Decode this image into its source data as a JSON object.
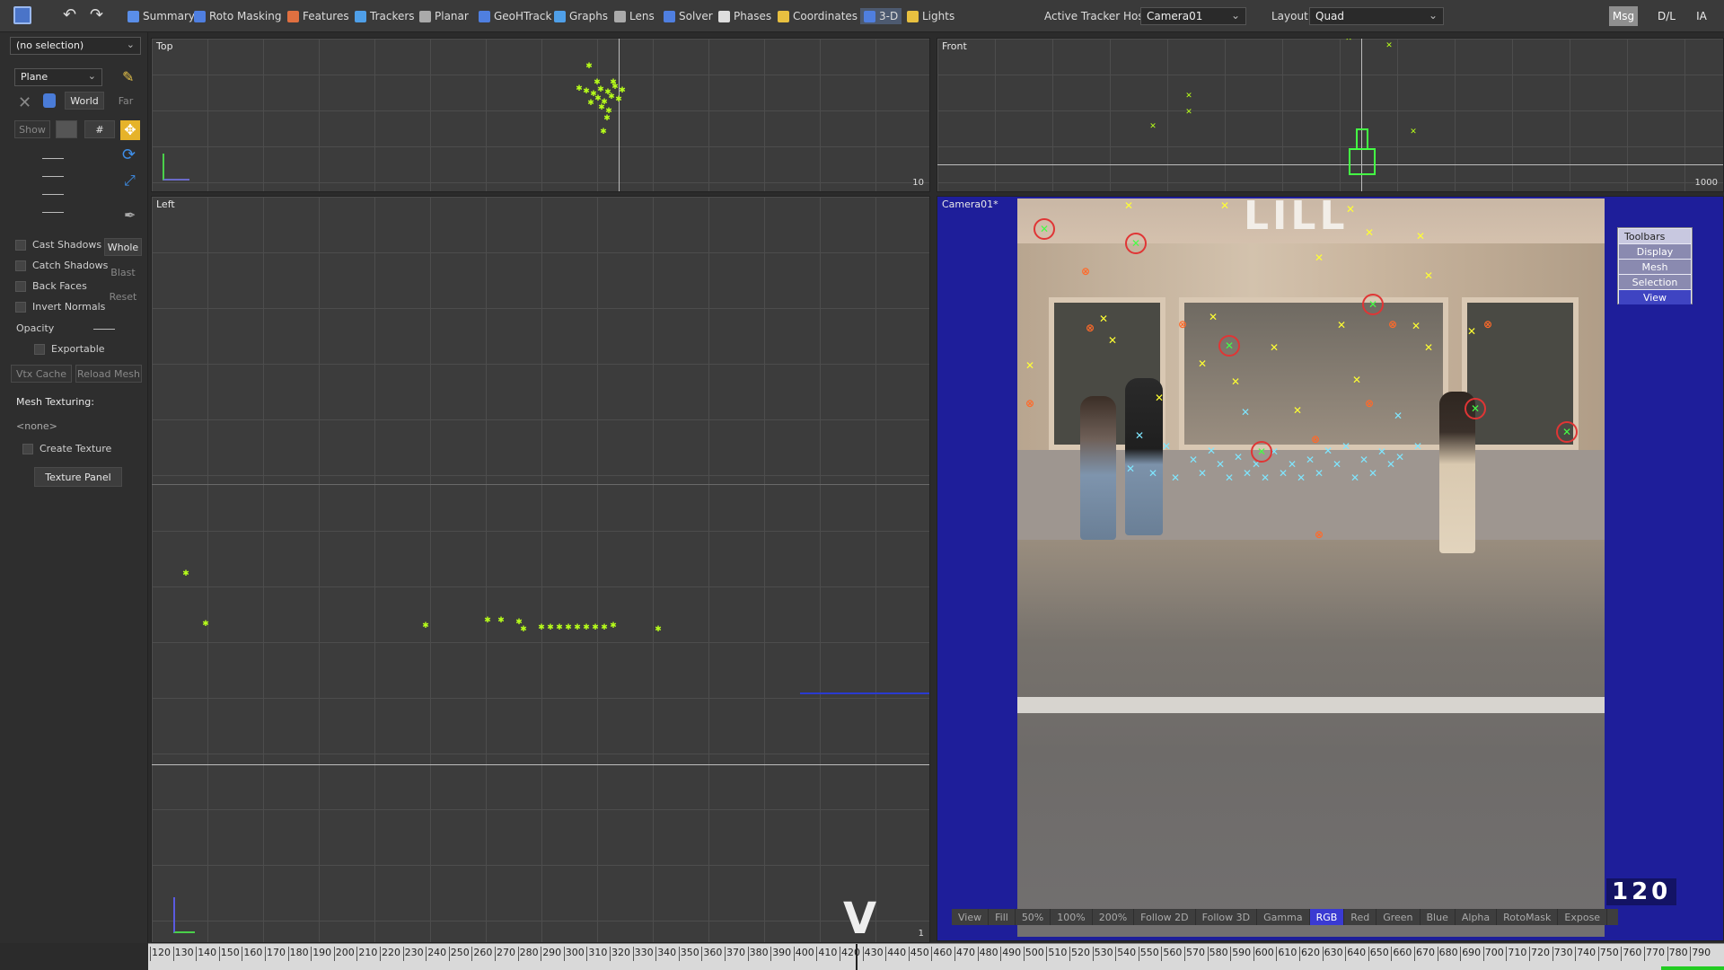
{
  "toolbar": {
    "items": [
      {
        "label": "Summary",
        "icon": "sigma-icon"
      },
      {
        "label": "Roto Masking",
        "icon": "roto-icon"
      },
      {
        "label": "Features",
        "icon": "features-icon"
      },
      {
        "label": "Trackers",
        "icon": "trackers-icon"
      },
      {
        "label": "Planar",
        "icon": "planar-icon"
      },
      {
        "label": "GeoHTrack",
        "icon": "geohtrack-icon"
      },
      {
        "label": "Graphs",
        "icon": "graphs-icon"
      },
      {
        "label": "Lens",
        "icon": "lens-icon"
      },
      {
        "label": "Solver",
        "icon": "solver-icon"
      },
      {
        "label": "Phases",
        "icon": "phases-icon"
      },
      {
        "label": "Coordinates",
        "icon": "coordinates-icon"
      },
      {
        "label": "3-D",
        "icon": "cube-icon"
      },
      {
        "label": "Lights",
        "icon": "bulb-icon"
      }
    ],
    "tracker_host_label": "Active Tracker Host:",
    "tracker_host_value": "Camera01",
    "layout_label": "Layout:",
    "layout_value": "Quad",
    "right_buttons": [
      "Msg",
      "D/L",
      "IA"
    ]
  },
  "left_panel": {
    "selection": "(no selection)",
    "primitive": "Plane",
    "world": "World",
    "far": "Far",
    "show": "Show",
    "hash": "#",
    "cast_shadows": "Cast Shadows",
    "catch_shadows": "Catch Shadows",
    "back_faces": "Back Faces",
    "invert_normals": "Invert Normals",
    "whole": "Whole",
    "blast": "Blast",
    "reset": "Reset",
    "opacity": "Opacity",
    "exportable": "Exportable",
    "vtx_cache": "Vtx Cache",
    "reload_mesh": "Reload Mesh",
    "mesh_texturing": "Mesh Texturing:",
    "none": "<none>",
    "create_texture": "Create Texture",
    "texture_panel": "Texture Panel"
  },
  "viewports": {
    "top": {
      "label": "Top",
      "corner": "10"
    },
    "front": {
      "label": "Front",
      "corner": "1000"
    },
    "left": {
      "label": "Left",
      "corner": "1"
    },
    "camera": {
      "label": "Camera01*"
    }
  },
  "camera_toolbars": {
    "title": "Toolbars",
    "items": [
      "Display",
      "Mesh",
      "Selection",
      "View"
    ]
  },
  "view_bar": [
    "View",
    "Fill",
    "50%",
    "100%",
    "200%",
    "Follow 2D",
    "Follow 3D",
    "Gamma",
    "RGB",
    "Red",
    "Green",
    "Blue",
    "Alpha",
    "RotoMask",
    "Expose"
  ],
  "view_bar_active": "RGB",
  "photo_sign": "LILL",
  "frame_number": "120",
  "timeline_ticks": [
    "120",
    "130",
    "140",
    "150",
    "160",
    "170",
    "180",
    "190",
    "200",
    "210",
    "220",
    "230",
    "240",
    "250",
    "260",
    "270",
    "280",
    "290",
    "300",
    "310",
    "320",
    "330",
    "340",
    "350",
    "360",
    "370",
    "380",
    "390",
    "400",
    "410",
    "420",
    "430",
    "440",
    "450",
    "460",
    "470",
    "480",
    "490",
    "500",
    "510",
    "520",
    "530",
    "540",
    "550",
    "560",
    "570",
    "580",
    "590",
    "600",
    "610",
    "620",
    "630",
    "640",
    "650",
    "660",
    "670",
    "680",
    "690",
    "700",
    "710",
    "720",
    "730",
    "740",
    "750",
    "760",
    "770",
    "780",
    "790"
  ],
  "colors": {
    "accent": "#3a3ad2",
    "tracker_green": "#b8ff1a",
    "tracker_yellow": "#ffff33",
    "camera_bg": "#1e1e9a"
  }
}
